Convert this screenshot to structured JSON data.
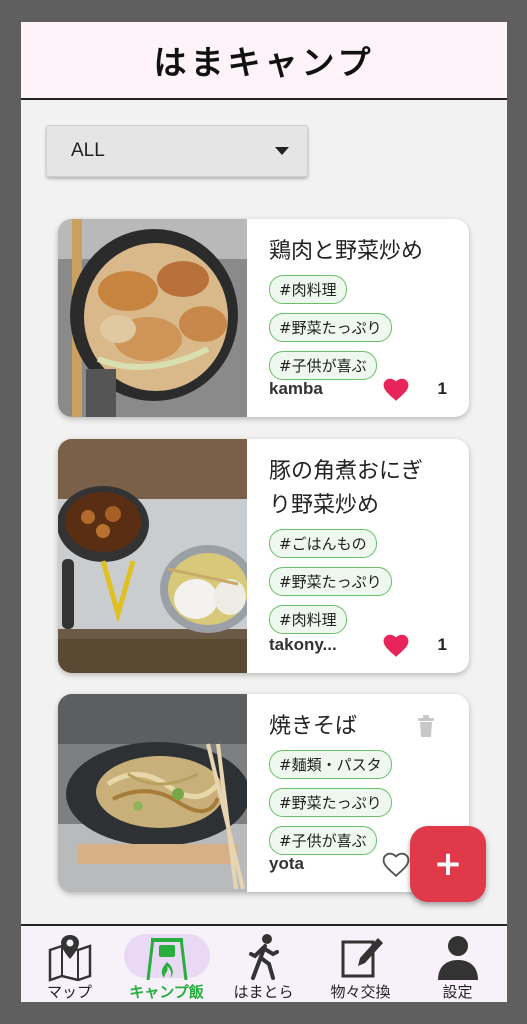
{
  "app": {
    "title": "はまキャンプ"
  },
  "filter": {
    "selected": "ALL"
  },
  "posts": [
    {
      "title_lines": [
        "鶏肉と野菜炒め"
      ],
      "tags": [
        "#肉料理",
        "#野菜たっぷり",
        "#子供が喜ぶ"
      ],
      "user": "kamba",
      "liked": true,
      "likes": "1"
    },
    {
      "title_lines": [
        "豚の角煮おにぎ",
        "り野菜炒め"
      ],
      "tags": [
        "#ごはんもの",
        "#野菜たっぷり",
        "#肉料理"
      ],
      "user": "takony...",
      "liked": true,
      "likes": "1"
    },
    {
      "title_lines": [
        "焼きそば"
      ],
      "tags": [
        "#麺類・パスタ",
        "#野菜たっぷり",
        "#子供が喜ぶ"
      ],
      "user": "yota",
      "liked": false,
      "likes": ""
    }
  ],
  "fab": {
    "label": "+"
  },
  "nav": [
    {
      "label": "マップ",
      "icon": "map-icon"
    },
    {
      "label": "キャンプ飯",
      "icon": "campfire-cooking-icon",
      "active": true
    },
    {
      "label": "はまとら",
      "icon": "walking-person-icon"
    },
    {
      "label": "物々交換",
      "icon": "edit-note-icon"
    },
    {
      "label": "設定",
      "icon": "user-settings-icon"
    }
  ],
  "colors": {
    "accent_red": "#e03a4a",
    "heart": "#e8245c",
    "tag_border": "#6abf69",
    "active_nav": "#27ae3c"
  }
}
